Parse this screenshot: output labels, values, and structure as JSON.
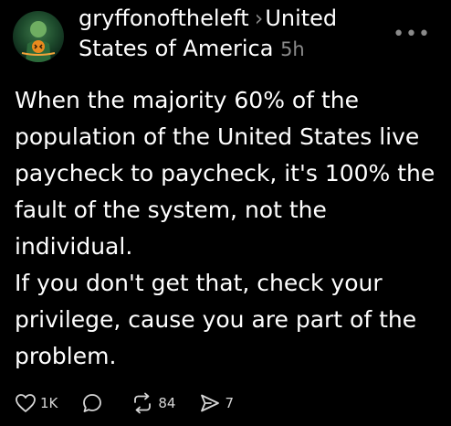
{
  "post": {
    "username": "gryffonoftheleft",
    "chevron": "›",
    "community": "United States of America",
    "time": "5h",
    "more_icon": "more-options-icon",
    "body": [
      "When the majority 60% of the population of the United States live paycheck to paycheck, it's 100% the fault of the system, not the individual.",
      "If you don't get that, check your privilege, cause you are part of the problem."
    ],
    "actions": {
      "likes": "1K",
      "reposts": "84",
      "shares": "7"
    }
  },
  "colors": {
    "background": "#000000",
    "text": "#ffffff",
    "muted": "#8a8a8a"
  }
}
